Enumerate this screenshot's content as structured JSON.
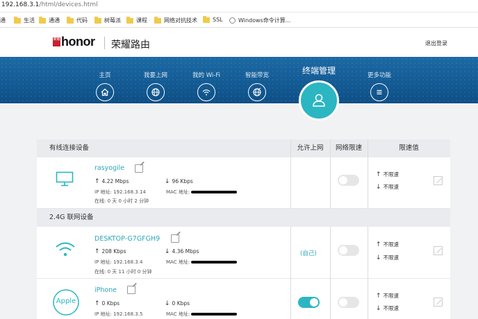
{
  "browser": {
    "url_host": "192.168.3.1",
    "url_path": "/html/devices.html",
    "bookmarks": [
      "通",
      "生活",
      "通通",
      "代码",
      "树莓派",
      "课程",
      "网络对抗技术",
      "SSL",
      "Windows命令计算..."
    ]
  },
  "header": {
    "logo_badge": "荣耀",
    "logo_text": "honor",
    "product_name": "荣耀路由",
    "logout": "退出登录"
  },
  "nav": {
    "items": [
      {
        "label": "主页",
        "icon": "home-icon"
      },
      {
        "label": "我要上网",
        "icon": "globe-icon"
      },
      {
        "label": "我的 Wi-Fi",
        "icon": "wifi-icon"
      },
      {
        "label": "智能带宽",
        "icon": "bandwidth-icon"
      },
      {
        "label": "更多功能",
        "icon": "menu-icon"
      }
    ],
    "active": {
      "label": "终端管理",
      "icon": "user-icon"
    }
  },
  "table": {
    "headers": {
      "device": "有线连接设备",
      "allow": "允许上网",
      "limit": "网络限速",
      "limit_value": "限速值"
    },
    "section_24g": "2.4G 联网设备",
    "rows": [
      {
        "name": "rasyogile",
        "icon": "monitor-icon",
        "up": "4.22 Mbps",
        "down": "96 Kbps",
        "ip": "IP 地址: 192.168.3.14",
        "mac": "MAC 地址:",
        "online": "在线: 0 天 0 小时 2 分钟",
        "allow": "",
        "limit_on": false,
        "limit_up": "不限速",
        "limit_down": "不限速"
      },
      {
        "name": "DESKTOP-G7GFGH9",
        "icon": "wifi-device-icon",
        "up": "208 Kbps",
        "down": "4.36 Mbps",
        "ip": "IP 地址: 192.168.3.4",
        "mac": "MAC 地址:",
        "online": "在线: 0 天 11 小时 0 分钟",
        "allow": "(自己)",
        "limit_on": false,
        "limit_up": "不限速",
        "limit_down": "不限速"
      },
      {
        "name": "iPhone",
        "icon": "apple-icon",
        "icon_text": "Apple",
        "up": "0 Kbps",
        "down": "0 Kbps",
        "ip": "IP 地址: 192.168.3.5",
        "mac": "MAC 地址:",
        "online": "",
        "allow": "",
        "allow_on": true,
        "limit_on": false,
        "limit_up": "不限速",
        "limit_down": "不限速"
      }
    ]
  },
  "colors": {
    "accent": "#2bb6c2",
    "nav_top": "#1c6aa5",
    "nav_bottom": "#0d4f86",
    "link": "#2aa7b8"
  }
}
